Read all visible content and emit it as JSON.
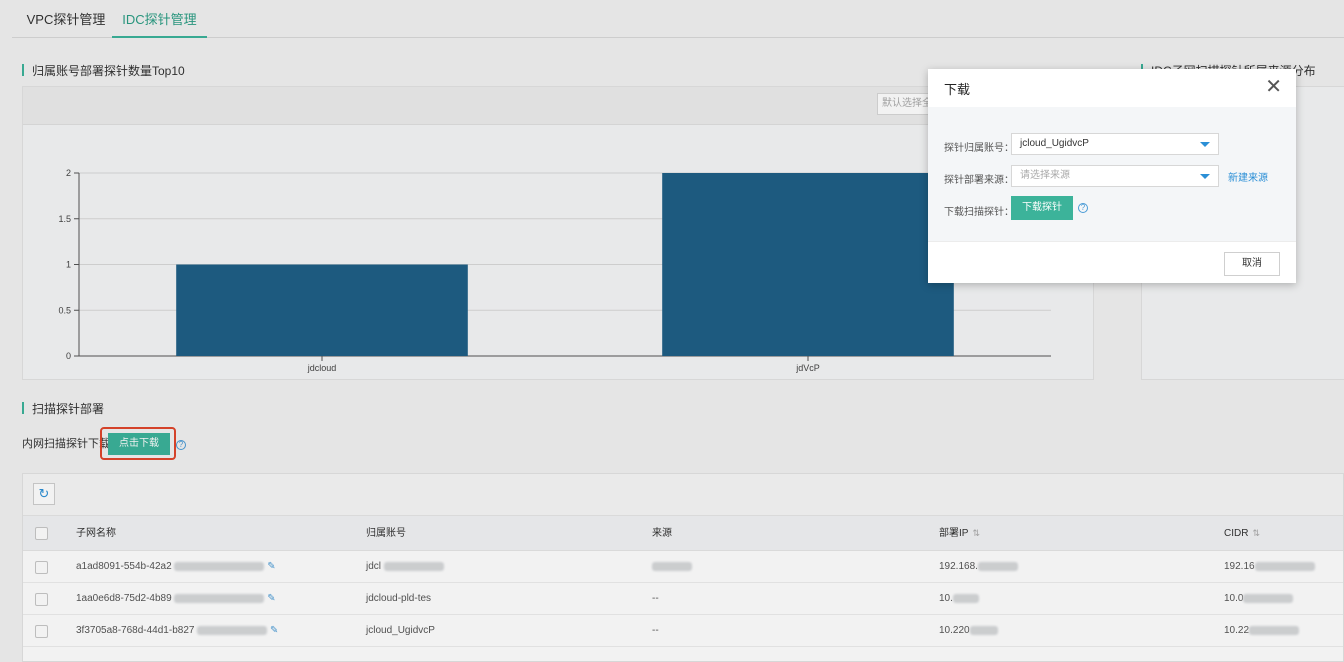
{
  "tabs": [
    {
      "label": "VPC探针管理",
      "active": false
    },
    {
      "label": "IDC探针管理",
      "active": true
    }
  ],
  "chart_section": {
    "title": "归属账号部署探针数量Top10",
    "select_placeholder": "默认选择全"
  },
  "right_section": {
    "title": "IDC子网扫描探针所属来源分布"
  },
  "chart_data": {
    "type": "bar",
    "categories": [
      "jdcloud",
      "jdVcP"
    ],
    "values": [
      1,
      2
    ],
    "ylim": [
      0,
      2
    ],
    "yticks": [
      "0",
      "0.5",
      "1",
      "1.5",
      "2"
    ],
    "xlabel": "",
    "ylabel": "",
    "color": "#1f5f86",
    "grid": true
  },
  "deploy_section": {
    "title": "扫描探针部署",
    "download_label": "内网扫描探针下载",
    "download_button": "点击下载",
    "help": "?"
  },
  "table": {
    "refresh_icon": "refresh-icon",
    "columns": [
      "子网名称",
      "归属账号",
      "来源",
      "部署IP",
      "CIDR"
    ],
    "rows": [
      {
        "subnet": "a1ad8091-554b-42a2",
        "account": "jdcl",
        "source": "",
        "ip": "192.168.",
        "cidr": "192.16"
      },
      {
        "subnet": "1aa0e6d8-75d2-4b89",
        "account": "jdcloud-pld-tes",
        "source": "--",
        "ip": "10.",
        "cidr": "10.0"
      },
      {
        "subnet": "3f3705a8-768d-44d1-b827",
        "account": "jcloud_UgidvcP",
        "source": "--",
        "ip": "10.220",
        "cidr": "10.22"
      }
    ]
  },
  "modal": {
    "title": "下载",
    "close_icon": "close-icon",
    "account_label": "探针归属账号：",
    "account_value": "jcloud_UgidvcP",
    "source_label": "探针部署来源：",
    "source_placeholder": "请选择来源",
    "new_source_link": "新建来源",
    "download_label": "下载扫描探针：",
    "download_button": "下载探针",
    "help": "?",
    "cancel_button": "取消"
  }
}
